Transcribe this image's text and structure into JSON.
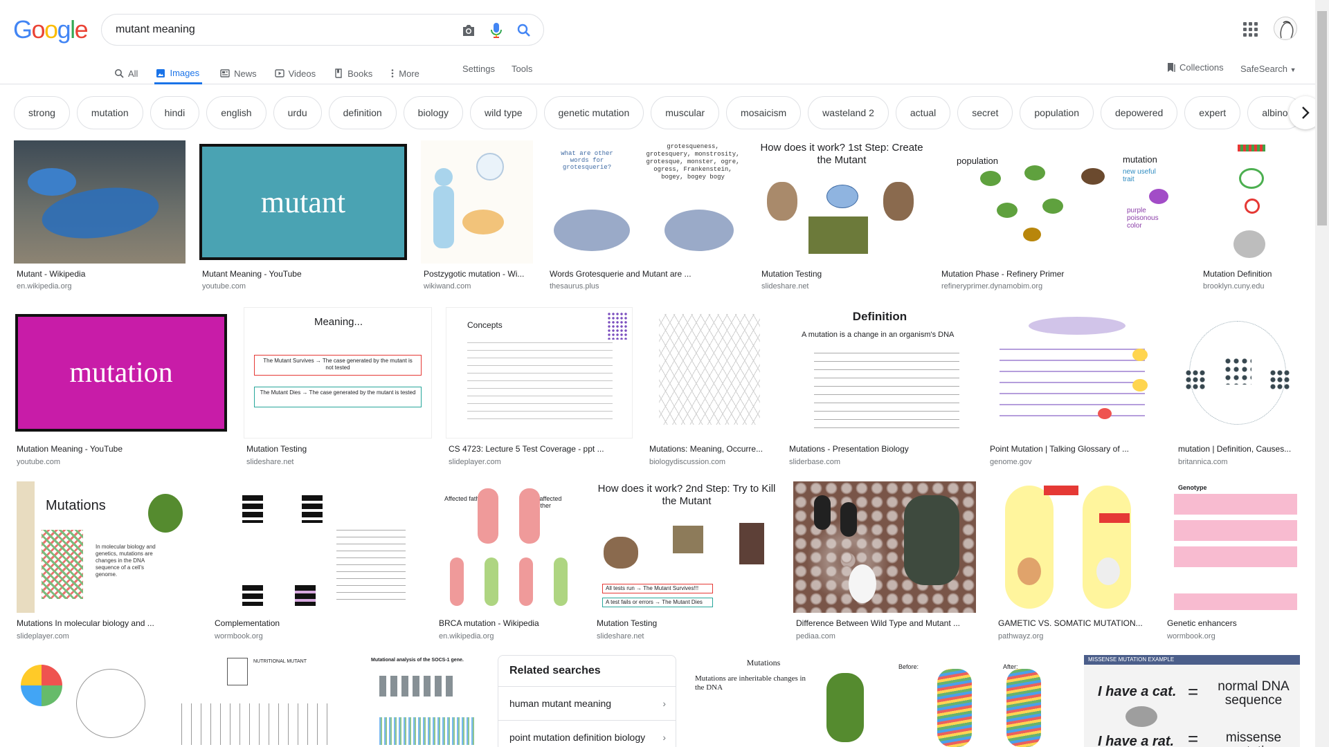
{
  "search": {
    "query": "mutant meaning"
  },
  "logo": {
    "letters": [
      "G",
      "o",
      "o",
      "g",
      "l",
      "e"
    ]
  },
  "colors": {
    "accent": "#1a73e8",
    "blue": "#4285f4",
    "red": "#ea4335",
    "yellow": "#fbbc05",
    "green": "#34a853"
  },
  "tabs": [
    {
      "label": "All",
      "icon": "search-icon",
      "active": false
    },
    {
      "label": "Images",
      "icon": "image-icon",
      "active": true
    },
    {
      "label": "News",
      "icon": "news-icon",
      "active": false
    },
    {
      "label": "Videos",
      "icon": "video-icon",
      "active": false
    },
    {
      "label": "Books",
      "icon": "book-icon",
      "active": false
    },
    {
      "label": "More",
      "icon": "more-vert-icon",
      "active": false
    }
  ],
  "tools": {
    "settings": "Settings",
    "tools": "Tools"
  },
  "collections": "Collections",
  "safesearch": "SafeSearch",
  "chips": [
    "strong",
    "mutation",
    "hindi",
    "english",
    "urdu",
    "definition",
    "biology",
    "wild type",
    "genetic mutation",
    "muscular",
    "mosaicism",
    "wasteland 2",
    "actual",
    "secret",
    "population",
    "depowered",
    "expert",
    "albino"
  ],
  "results": [
    {
      "caption": "Mutant - Wikipedia",
      "source": "en.wikipedia.org",
      "thumb_text": ""
    },
    {
      "caption": "Mutant Meaning - YouTube",
      "source": "youtube.com",
      "thumb_text": "mutant"
    },
    {
      "caption": "Postzygotic mutation - Wi...",
      "source": "wikiwand.com",
      "thumb_text": ""
    },
    {
      "caption": "Words Grotesquerie and Mutant are ...",
      "source": "thesaurus.plus",
      "thumb_text": "grotesqueness, grotesquery, monstrosity, grotesque, monster, ogre, ogress, Frankenstein, bogey, bogey bogy"
    },
    {
      "caption": "Mutation Testing",
      "source": "slideshare.net",
      "thumb_text": "How does it work? 1st Step: Create the Mutant"
    },
    {
      "caption": "Mutation Phase - Refinery Primer",
      "source": "refineryprimer.dynamobim.org",
      "thumb_text": "population"
    },
    {
      "caption": "Mutation Definition",
      "source": "brooklyn.cuny.edu",
      "thumb_text": ""
    },
    {
      "caption": "Mutation Meaning - YouTube",
      "source": "youtube.com",
      "thumb_text": "mutation"
    },
    {
      "caption": "Mutation Testing",
      "source": "slideshare.net",
      "thumb_text": "Meaning..."
    },
    {
      "caption": "CS 4723: Lecture 5 Test Coverage - ppt ...",
      "source": "slideplayer.com",
      "thumb_text": "Concepts"
    },
    {
      "caption": "Mutations: Meaning, Occurre...",
      "source": "biologydiscussion.com",
      "thumb_text": ""
    },
    {
      "caption": "Mutations - Presentation Biology",
      "source": "sliderbase.com",
      "thumb_text": "Definition"
    },
    {
      "caption": "Point Mutation | Talking Glossary of ...",
      "source": "genome.gov",
      "thumb_text": ""
    },
    {
      "caption": "mutation | Definition, Causes...",
      "source": "britannica.com",
      "thumb_text": ""
    },
    {
      "caption": "Mutations In molecular biology and ...",
      "source": "slideplayer.com",
      "thumb_text": "Mutations"
    },
    {
      "caption": "Complementation",
      "source": "wormbook.org",
      "thumb_text": ""
    },
    {
      "caption": "BRCA mutation - Wikipedia",
      "source": "en.wikipedia.org",
      "thumb_text": ""
    },
    {
      "caption": "Mutation Testing",
      "source": "slideshare.net",
      "thumb_text": "How does it work? 2nd Step: Try to Kill the Mutant"
    },
    {
      "caption": "Difference Between Wild Type and Mutant ...",
      "source": "pediaa.com",
      "thumb_text": ""
    },
    {
      "caption": "GAMETIC VS. SOMATIC MUTATION...",
      "source": "pathwayz.org",
      "thumb_text": ""
    },
    {
      "caption": "Genetic enhancers",
      "source": "wormbook.org",
      "thumb_text": "Genotype"
    }
  ],
  "bottom_thumbs": [
    {
      "thumb_text": ""
    },
    {
      "thumb_text": "NUTRITIONAL MUTANT"
    },
    {
      "thumb_text": "Mutational analysis of the SOCS-1 gene."
    },
    {
      "thumb_text": "Mutations"
    },
    {
      "thumb_text": "Before: After:"
    },
    {
      "thumb_text": "MISSENSE MUTATION EXAMPLE"
    }
  ],
  "related": {
    "title": "Related searches",
    "items": [
      "human mutant meaning",
      "point mutation definition biology"
    ]
  },
  "slide_texts": {
    "mutant_survives": "The Mutant Survives → The case generated by the mutant is not tested",
    "mutant_dies": "The Mutant Dies → The case generated by the mutant is tested",
    "definition_lead": "A mutation is a change in an organism's DNA",
    "mutations_lead": "Mutations are inheritable changes in the DNA",
    "cat": "I have a cat.",
    "rat": "I have a rat.",
    "normal": "normal DNA sequence",
    "missense": "missense mutation",
    "all_tests": "All tests run → The Mutant Survives!!!",
    "test_fails": "A test fails or errors → The Mutant Dies",
    "mutations_body": "In molecular biology and genetics, mutations are changes in the DNA sequence of a cell's genome.",
    "new_trait": "new useful trait",
    "purple": "purple poisonous color",
    "mutation_label": "mutation",
    "what_other": "what are other words for grotesquerie?",
    "affected_father": "Affected father",
    "unaffected_mother": "Unaffected mother"
  }
}
